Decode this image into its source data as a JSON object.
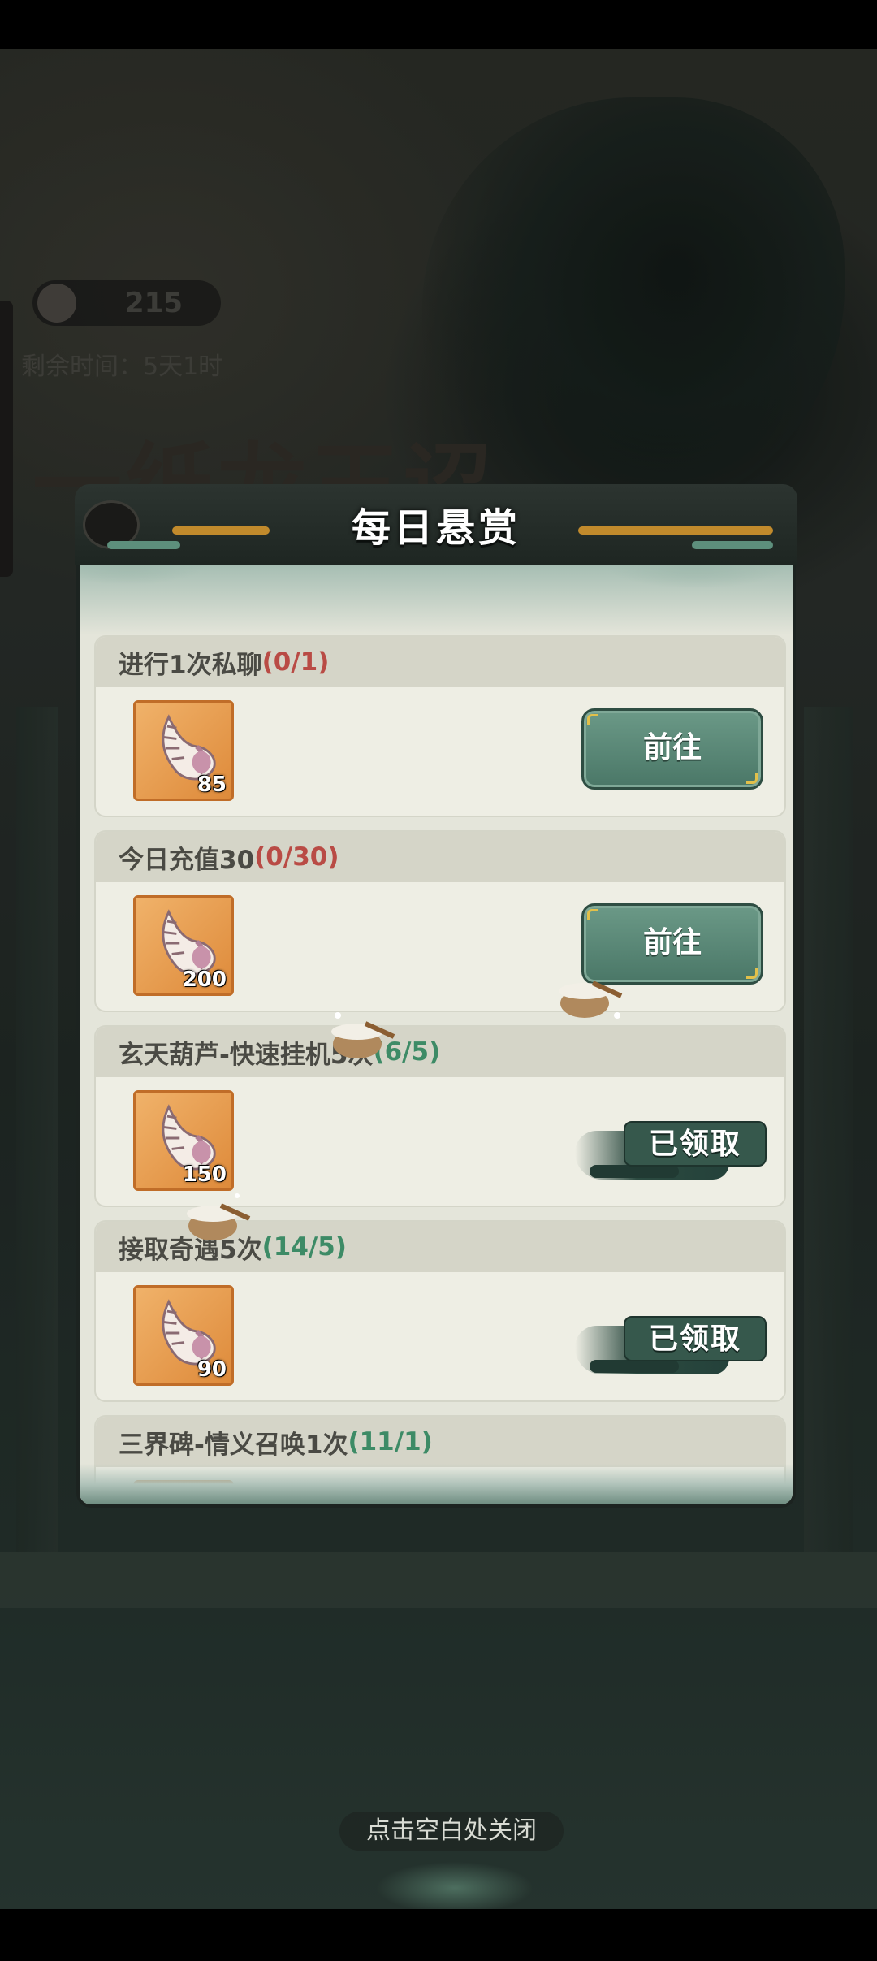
{
  "dialog": {
    "title": "每日悬赏"
  },
  "background": {
    "counter_value": "215",
    "time_label": "剩余时间：5天1时",
    "event_title": "一纸龙王诏"
  },
  "tasks": [
    {
      "name": "进行1次私聊",
      "progress": "(0/1)",
      "status": "pending",
      "reward_count": "85",
      "action_label": "前往"
    },
    {
      "name": "今日充值30",
      "progress": "(0/30)",
      "status": "pending",
      "reward_count": "200",
      "action_label": "前往"
    },
    {
      "name": "玄天葫芦-快速挂机5次",
      "progress": "(6/5)",
      "status": "done",
      "reward_count": "150",
      "action_label": "已领取"
    },
    {
      "name": "接取奇遇5次",
      "progress": "(14/5)",
      "status": "done",
      "reward_count": "90",
      "action_label": "已领取"
    },
    {
      "name": "三界碑-情义召唤1次",
      "progress": "(11/1)",
      "status": "done",
      "reward_count": "",
      "action_label": ""
    }
  ],
  "reward_icon": "conch-shell-icon",
  "close_hint": "点击空白处关闭",
  "colors": {
    "pending": "#b94b45",
    "done": "#3d8b66",
    "button": "#4a7767"
  }
}
